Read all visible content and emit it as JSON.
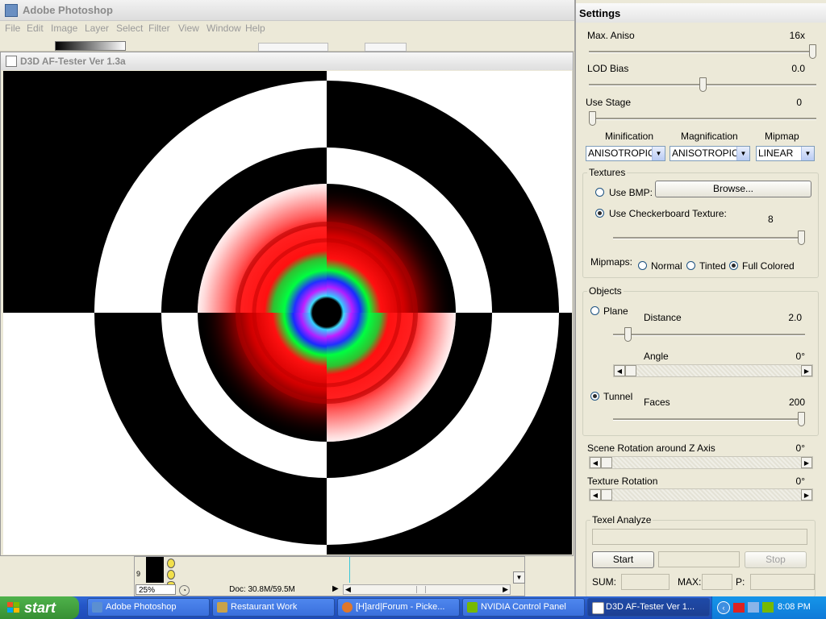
{
  "photoshop": {
    "title": "Adobe Photoshop",
    "menu": [
      "File",
      "Edit",
      "Image",
      "Layer",
      "Select",
      "Filter",
      "View",
      "Window",
      "Help"
    ],
    "zoom": "25%",
    "doc_info": "Doc: 30.8M/59.5M",
    "layer_num": "9"
  },
  "af_window": {
    "title": "D3D AF-Tester Ver 1.3a"
  },
  "settings": {
    "title": "Settings",
    "max_aniso": {
      "label": "Max. Aniso",
      "value": "16x",
      "level": 1.0
    },
    "lod_bias": {
      "label": "LOD Bias",
      "value": "0.0",
      "level": 0.5
    },
    "use_stage": {
      "label": "Use Stage",
      "value": "0",
      "level": 0.0
    },
    "filters": {
      "minification_label": "Minification",
      "magnification_label": "Magnification",
      "mipmap_label": "Mipmap",
      "minification": "ANISOTROPIC",
      "magnification": "ANISOTROPIC",
      "mipmap": "LINEAR"
    },
    "textures": {
      "group_title": "Textures",
      "use_bmp": "Use BMP:",
      "browse": "Browse...",
      "use_checkerboard": "Use Checkerboard Texture:",
      "checker_value": "8",
      "checker_level": 1.0,
      "mipmaps_label": "Mipmaps:",
      "normal": "Normal",
      "tinted": "Tinted",
      "full_colored": "Full Colored"
    },
    "objects": {
      "group_title": "Objects",
      "plane": "Plane",
      "distance_label": "Distance",
      "distance_value": "2.0",
      "distance_level": 0.06,
      "angle_label": "Angle",
      "angle_value": "0°",
      "tunnel": "Tunnel",
      "faces_label": "Faces",
      "faces_value": "200",
      "faces_level": 1.0
    },
    "scene_rotation": {
      "label": "Scene Rotation around Z Axis",
      "value": "0°"
    },
    "texture_rotation": {
      "label": "Texture Rotation",
      "value": "0°"
    },
    "texel": {
      "group_title": "Texel Analyze",
      "start": "Start",
      "stop": "Stop",
      "sum": "SUM:",
      "max": "MAX:",
      "p": "P:"
    }
  },
  "taskbar": {
    "start": "start",
    "tasks": [
      {
        "label": "Adobe Photoshop"
      },
      {
        "label": "Restaurant Work"
      },
      {
        "label": "[H]ard|Forum - Picke..."
      },
      {
        "label": "NVIDIA Control Panel"
      },
      {
        "label": "D3D AF-Tester Ver 1..."
      }
    ],
    "clock": "8:08 PM"
  },
  "colors": {
    "taskbar_blue": "#2456c7",
    "start_green": "#3a9b36",
    "tray_blue": "#0f7ad8"
  }
}
